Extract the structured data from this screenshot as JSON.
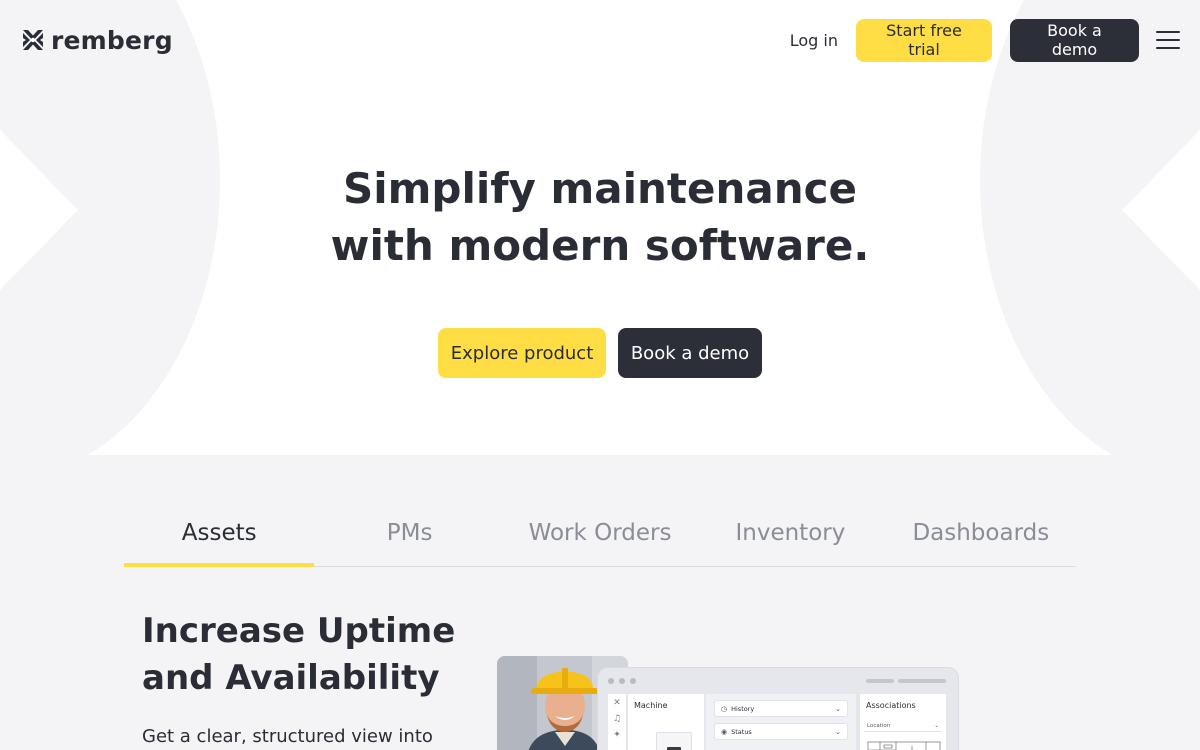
{
  "brand": {
    "name": "remberg"
  },
  "header": {
    "login_label": "Log in",
    "trial_label": "Start free trial",
    "demo_label": "Book a demo"
  },
  "hero": {
    "title_line1_regular": "Simplify ",
    "title_line1_bold": "maintenance",
    "title_line2_regular": "with ",
    "title_line2_bold": "modern software",
    "title_line2_end": ".",
    "explore_label": "Explore product",
    "demo_label": "Book a demo"
  },
  "tabs": [
    {
      "label": "Assets",
      "active": true
    },
    {
      "label": "PMs",
      "active": false
    },
    {
      "label": "Work Orders",
      "active": false
    },
    {
      "label": "Inventory",
      "active": false
    },
    {
      "label": "Dashboards",
      "active": false
    }
  ],
  "content": {
    "title": "Increase Uptime and Availability",
    "text": "Get a clear, structured view into"
  },
  "mockup": {
    "machine_title": "Machine",
    "history_label": "History",
    "status_label": "Status",
    "associations_title": "Associations",
    "location_label": "Location"
  },
  "colors": {
    "accent_yellow": "#ffde45",
    "dark": "#2c2f38",
    "background": "#f4f4f7"
  },
  "icons": {
    "logo": "remberg-x-logo-icon",
    "menu": "hamburger-menu-icon"
  }
}
